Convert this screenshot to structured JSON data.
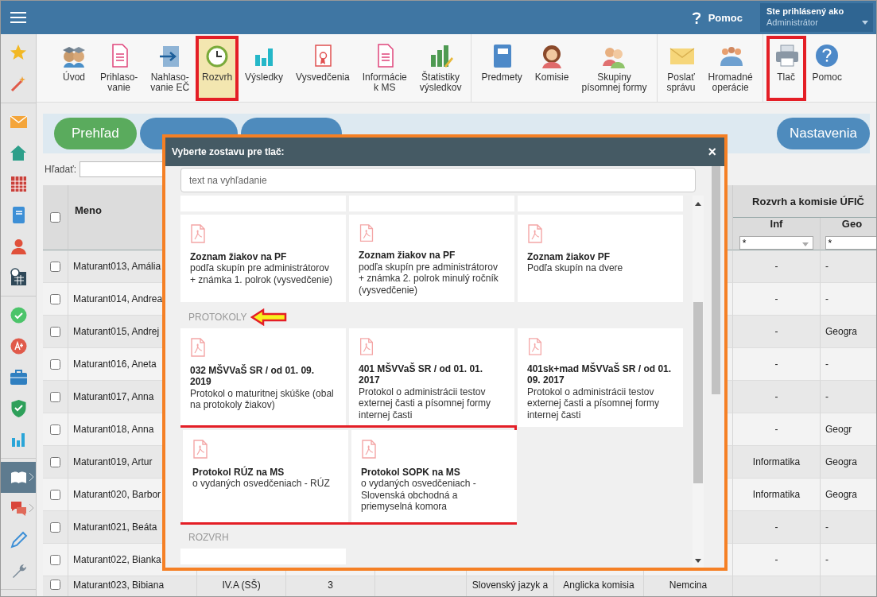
{
  "topbar": {
    "help": "Pomoc",
    "user_label": "Ste prihlásený ako",
    "user_name": "Administrátor"
  },
  "sidebar": {
    "groups": [
      [
        {
          "selected": false
        },
        {
          "selected": false
        }
      ],
      [
        {
          "selected": false
        },
        {
          "selected": false
        },
        {
          "selected": false
        },
        {
          "selected": false
        },
        {
          "selected": false
        },
        {
          "selected": false
        }
      ],
      [
        {
          "selected": false
        },
        {
          "selected": false
        },
        {
          "selected": false
        },
        {
          "selected": false
        },
        {
          "selected": false
        }
      ],
      [
        {
          "selected": true,
          "expandable": true
        },
        {
          "selected": false,
          "expandable": true
        },
        {
          "selected": false
        },
        {
          "selected": false
        }
      ]
    ]
  },
  "toolbar": {
    "groups": [
      [
        {
          "label": "Úvod",
          "selected": false,
          "highlighted": false
        },
        {
          "label": "Prihlaso-\nvanie",
          "selected": false,
          "highlighted": false
        },
        {
          "label": "Nahlaso-\nvanie EČ",
          "selected": false,
          "highlighted": false
        },
        {
          "label": "Rozvrh",
          "selected": true,
          "highlighted": true
        },
        {
          "label": "Výsledky",
          "selected": false,
          "highlighted": false
        },
        {
          "label": "Vysvedčenia",
          "selected": false,
          "highlighted": false
        },
        {
          "label": "Informácie\nk MS",
          "selected": false,
          "highlighted": false
        },
        {
          "label": "Štatistiky\nvýsledkov",
          "selected": false,
          "highlighted": false
        }
      ],
      [
        {
          "label": "Predmety",
          "selected": false,
          "highlighted": false
        },
        {
          "label": "Komisie",
          "selected": false,
          "highlighted": false
        },
        {
          "label": "Skupiny\npísomnej formy",
          "selected": false,
          "highlighted": false
        }
      ],
      [
        {
          "label": "Poslať\nsprávu",
          "selected": false,
          "highlighted": false
        },
        {
          "label": "Hromadné\noperácie",
          "selected": false,
          "highlighted": false
        }
      ],
      [
        {
          "label": "Tlač",
          "selected": false,
          "highlighted": true
        },
        {
          "label": "Pomoc",
          "selected": false,
          "highlighted": false
        }
      ]
    ]
  },
  "tabs": [
    {
      "label": "Prehľad",
      "selected": true
    },
    {
      "selected": false
    },
    {
      "selected": false
    }
  ],
  "settings_button": "Nastavenia",
  "search": {
    "label": "Hľadať:"
  },
  "table": {
    "group_header": "Rozvrh a komisie ÚFIČ",
    "select_all_checked": false,
    "columns": [
      {
        "label": "Meno"
      },
      {},
      {},
      {},
      {},
      {},
      {},
      {
        "label": "Inf",
        "filter": "*"
      },
      {
        "label": "Geo",
        "filter": "*"
      }
    ],
    "rows": [
      {
        "checked": false,
        "cells": [
          "Maturant013, Amália",
          "",
          "",
          "",
          "",
          "",
          "",
          "-",
          "-"
        ]
      },
      {
        "checked": false,
        "cells": [
          "Maturant014, Andrea",
          "",
          "",
          "",
          "",
          "",
          "",
          "-",
          "-"
        ]
      },
      {
        "checked": false,
        "cells": [
          "Maturant015, Andrej",
          "",
          "",
          "",
          "",
          "",
          "",
          "-",
          "Geogra"
        ]
      },
      {
        "checked": false,
        "cells": [
          "Maturant016, Aneta",
          "",
          "",
          "",
          "",
          "",
          "",
          "-",
          "-"
        ]
      },
      {
        "checked": false,
        "cells": [
          "Maturant017, Anna",
          "",
          "",
          "",
          "",
          "",
          "",
          "-",
          "-"
        ]
      },
      {
        "checked": false,
        "cells": [
          "Maturant018, Anna",
          "",
          "",
          "",
          "",
          "",
          "",
          "-",
          "Geogr"
        ]
      },
      {
        "checked": false,
        "cells": [
          "Maturant019, Artur",
          "",
          "",
          "",
          "",
          "",
          "",
          "Informatika",
          "Geogra"
        ]
      },
      {
        "checked": false,
        "cells": [
          "Maturant020, Barbor",
          "",
          "",
          "",
          "",
          "",
          "",
          "Informatika",
          "Geogra"
        ]
      },
      {
        "checked": false,
        "cells": [
          "Maturant021, Beáta",
          "",
          "",
          "",
          "",
          "",
          "",
          "-",
          "-"
        ]
      },
      {
        "checked": false,
        "cells": [
          "Maturant022, Bianka",
          "",
          "",
          "",
          "",
          "",
          "",
          "-",
          "-"
        ]
      },
      {
        "checked": false,
        "cells": [
          "Maturant023, Bibiana",
          "IV.A (SŠ)",
          "3",
          "",
          "Slovenský jazyk a",
          "Anglicka komisia",
          "Nemcina",
          "",
          ""
        ]
      }
    ]
  },
  "dialog": {
    "title": "Vyberte zostavu pre tlač:",
    "close": "×",
    "search_placeholder": "text na vyhľadanie",
    "sections": [
      {
        "cards": [
          {
            "clipped": true
          },
          {
            "clipped": true
          },
          {
            "clipped": true
          }
        ]
      },
      {
        "cards": [
          {
            "title": "Zoznam žiakov na PF",
            "text": "podľa skupín pre administrátorov + známka 1. polrok (vysvedčenie)"
          },
          {
            "title": "Zoznam žiakov na PF",
            "text": "podľa skupín pre administrátorov + známka 2. polrok minulý ročník (vysvedčenie)"
          },
          {
            "title": "Zoznam žiakov PF",
            "text": "Podľa skupín na dvere"
          }
        ]
      },
      {
        "label": "PROTOKOLY",
        "arrow": true,
        "cards": [
          {
            "title": "032 MŠVVaŠ SR / od 01. 09. 2019",
            "text": "Protokol o maturitnej skúške (obal na protokoly žiakov)",
            "highlighted": false
          },
          {
            "title": "401 MŠVVaŠ SR / od 01. 01. 2017",
            "text": "Protokol o administrácii testov externej časti a písomnej formy internej časti",
            "highlighted": false
          },
          {
            "title": "401sk+mad MŠVVaŠ SR / od 01. 09. 2017",
            "text": "Protokol o administrácii testov externej časti a písomnej formy internej časti",
            "highlighted": false
          },
          {
            "title": "Protokol RÚZ na MS",
            "text": "o vydaných osvedčeniach - RÚZ",
            "highlighted": true
          },
          {
            "title": "Protokol SOPK na MS",
            "text": "o vydaných osvedčeniach - Slovenská obchodná a priemyselná komora",
            "highlighted": true
          }
        ]
      },
      {
        "label": "ROZVRH",
        "cards": [
          {
            "clipped": true
          }
        ]
      }
    ]
  }
}
